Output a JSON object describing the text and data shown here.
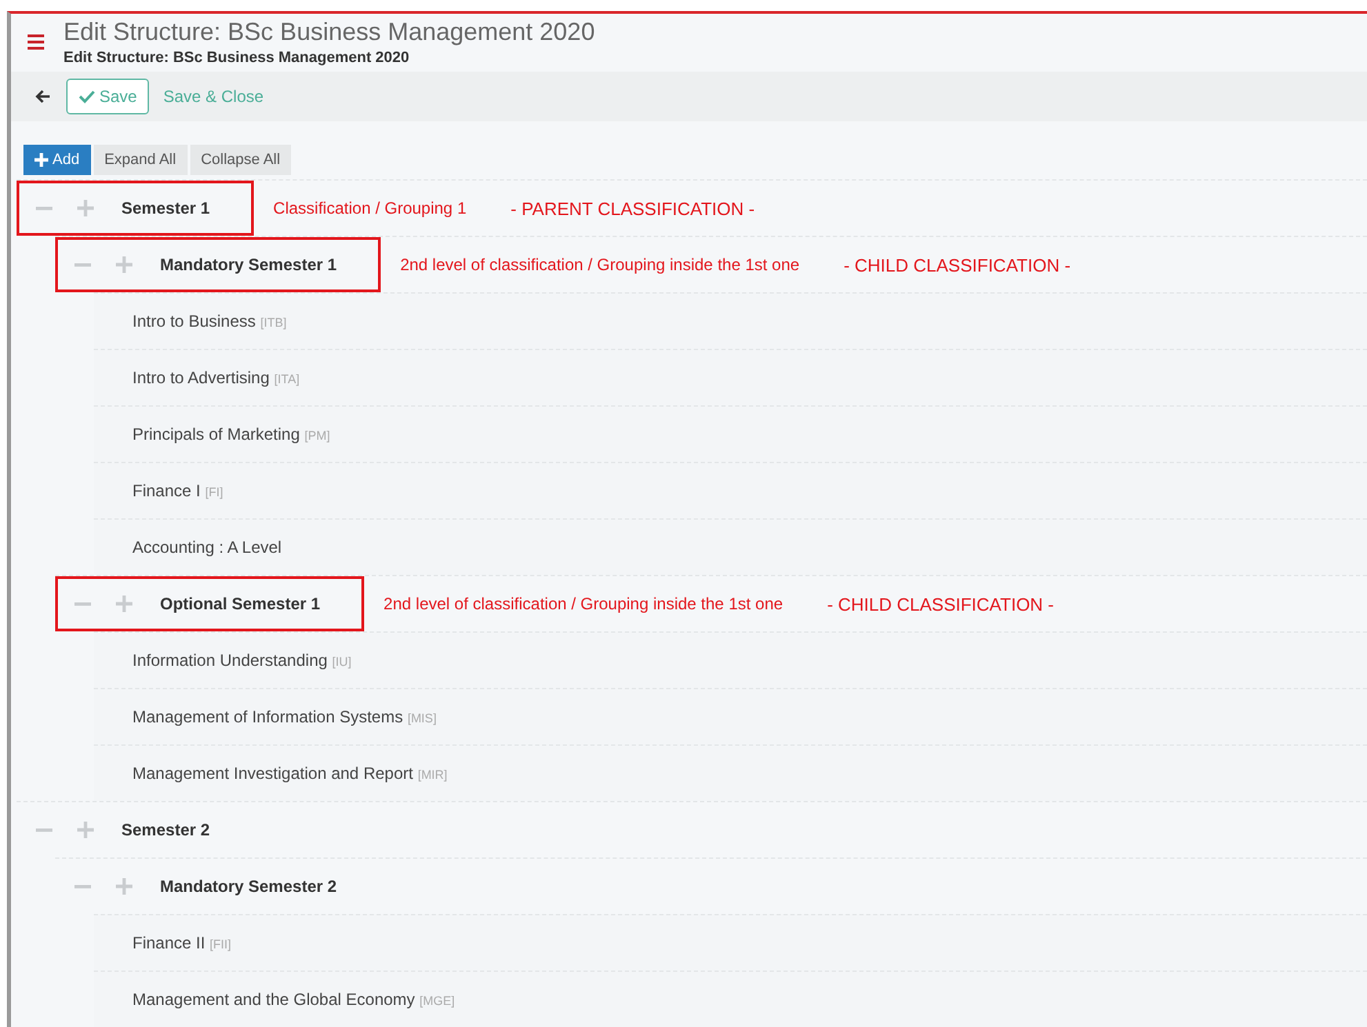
{
  "header": {
    "title": "Edit Structure: BSc Business Management 2020",
    "subtitle": "Edit Structure: BSc Business Management 2020"
  },
  "toolbar": {
    "save": "Save",
    "save_close": "Save & Close"
  },
  "actions": {
    "add": "Add",
    "expand_all": "Expand All",
    "collapse_all": "Collapse All"
  },
  "tree": [
    {
      "kind": "group",
      "label": "Semester 1",
      "highlighted": true,
      "note": "Classification / Grouping 1",
      "tag": "- PARENT CLASSIFICATION -",
      "children": [
        {
          "kind": "group",
          "label": "Mandatory Semester 1",
          "highlighted": true,
          "note": "2nd level of classification / Grouping inside the 1st one",
          "tag": "- CHILD CLASSIFICATION -",
          "children": [
            {
              "kind": "module",
              "label": "Intro to Business",
              "code": "[ITB]"
            },
            {
              "kind": "module",
              "label": "Intro to Advertising",
              "code": "[ITA]"
            },
            {
              "kind": "module",
              "label": "Principals of Marketing",
              "code": "[PM]"
            },
            {
              "kind": "module",
              "label": "Finance I",
              "code": "[FI]"
            },
            {
              "kind": "module",
              "label": "Accounting : A Level"
            }
          ]
        },
        {
          "kind": "group",
          "label": "Optional Semester 1",
          "highlighted": true,
          "note": "2nd level of classification / Grouping inside the 1st one",
          "tag": "- CHILD CLASSIFICATION -",
          "children": [
            {
              "kind": "module",
              "label": "Information Understanding",
              "code": "[IU]"
            },
            {
              "kind": "module",
              "label": "Management of Information Systems",
              "code": "[MIS]"
            },
            {
              "kind": "module",
              "label": "Management Investigation and Report",
              "code": "[MIR]"
            }
          ]
        }
      ]
    },
    {
      "kind": "group",
      "label": "Semester 2",
      "highlighted": false,
      "children": [
        {
          "kind": "group",
          "label": "Mandatory Semester 2",
          "highlighted": false,
          "children": [
            {
              "kind": "module",
              "label": "Finance II",
              "code": "[FII]"
            },
            {
              "kind": "module",
              "label": "Management and the Global Economy",
              "code": "[MGE]"
            }
          ]
        }
      ]
    }
  ]
}
